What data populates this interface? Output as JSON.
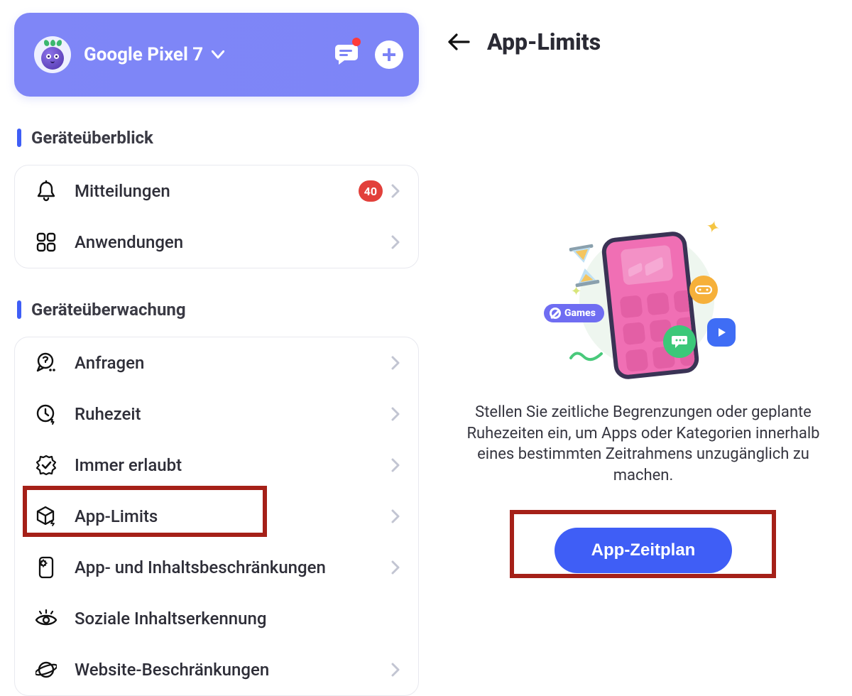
{
  "header": {
    "device_name": "Google Pixel 7"
  },
  "sections": {
    "overview_title": "Geräteüberblick",
    "monitoring_title": "Geräteüberwachung"
  },
  "overview": {
    "notifications_label": "Mitteilungen",
    "notifications_badge": "40",
    "apps_label": "Anwendungen"
  },
  "monitoring": {
    "requests_label": "Anfragen",
    "downtime_label": "Ruhezeit",
    "always_allowed_label": "Immer erlaubt",
    "app_limits_label": "App-Limits",
    "content_restrictions_label": "App- und Inhaltsbeschränkungen",
    "social_detection_label": "Soziale Inhaltserkennung",
    "website_restrictions_label": "Website-Beschränkungen"
  },
  "main": {
    "title": "App-Limits",
    "illustration_pill": "Games",
    "description": "Stellen Sie zeitliche Begrenzungen oder geplante Ruhezeiten ein, um Apps oder Kategorien innerhalb eines bestimmten Zeitrahmens unzugänglich zu machen.",
    "cta_label": "App-Zeitplan"
  }
}
